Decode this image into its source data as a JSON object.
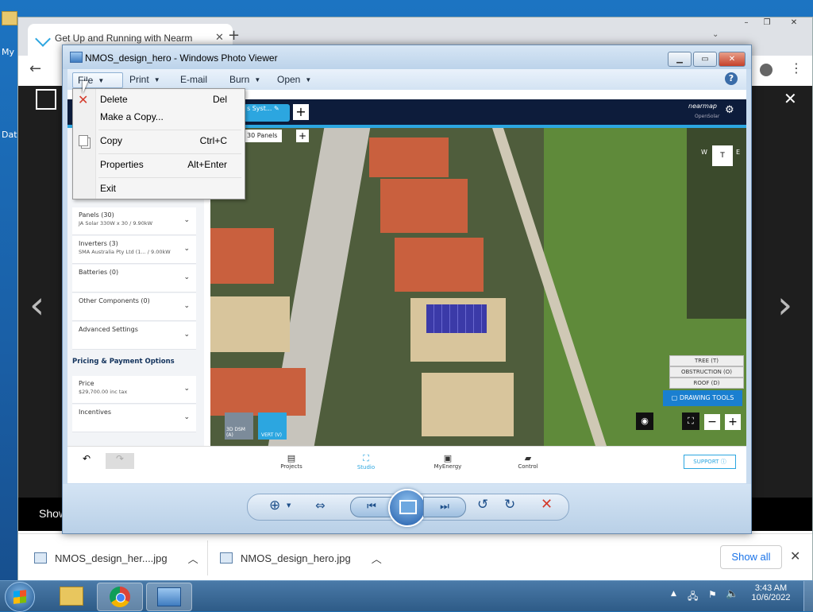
{
  "desktop": {
    "frag_top": "My",
    "frag_mid": "Dat"
  },
  "chrome": {
    "tab_title": "Get Up and Running with Nearm",
    "tab_close": "✕",
    "new_tab": "+",
    "caption_buttons": [
      "–",
      "❐",
      "✕"
    ],
    "page_footer_text": "Show",
    "prev_arrow": "‹",
    "next_arrow": "›",
    "close_overlay": "✕",
    "downloads": [
      {
        "name": "NMOS_design_her....jpg"
      },
      {
        "name": "NMOS_design_hero.jpg"
      }
    ],
    "show_all": "Show all",
    "downloads_close": "✕"
  },
  "viewer": {
    "title": "NMOS_design_hero - Windows Photo Viewer",
    "menu": {
      "file": "File",
      "print": "Print",
      "email": "E-mail",
      "burn": "Burn",
      "open": "Open"
    },
    "help": "?",
    "file_menu": [
      {
        "label": "Delete",
        "shortcut": "Del"
      },
      {
        "label": "Make a Copy...",
        "shortcut": ""
      },
      {
        "label": "Copy",
        "shortcut": "Ctrl+C"
      },
      {
        "label": "Properties",
        "shortcut": "Alt+Enter"
      },
      {
        "label": "Exit",
        "shortcut": ""
      }
    ]
  },
  "app": {
    "project_tab": "s Syst...",
    "panels_badge": "30 Panels",
    "brand": "nearmap",
    "brand_sub": "OpenSolar",
    "sidebar": {
      "rows": [
        {
          "main": "Panels (30)",
          "sub": "JA Solar 330W x 30 / 9.90kW"
        },
        {
          "main": "Inverters (3)",
          "sub": "SMA Australia Pty Ltd (1... / 9.00kW"
        },
        {
          "main": "Batteries (0)",
          "sub": ""
        },
        {
          "main": "Other Components (0)",
          "sub": ""
        },
        {
          "main": "Advanced Settings",
          "sub": ""
        }
      ],
      "pricing_title": "Pricing & Payment Options",
      "pricing_rows": [
        {
          "main": "Price",
          "sub": "$29,700.00 inc tax"
        },
        {
          "main": "Incentives",
          "sub": ""
        }
      ]
    },
    "map": {
      "view_button": "T",
      "compass_letters": "W",
      "compass_letters_2": "E",
      "tools": [
        "TREE (T)",
        "OBSTRUCTION (O)",
        "ROOF (D)"
      ],
      "drawing_tools": "DRAWING TOOLS",
      "view_3d": "3D DSM (A)",
      "view_vert": "VERT (V)",
      "zoom_minus": "−",
      "zoom_plus": "+"
    },
    "footer": {
      "nav": [
        "Projects",
        "Studio",
        "MyEnergy",
        "Control"
      ],
      "support": "SUPPORT"
    }
  },
  "taskbar": {
    "time": "3:43 AM",
    "date": "10/6/2022"
  },
  "colors": {
    "nearmap_navy": "#0d1c3b",
    "nearmap_blue": "#2ca6e0",
    "delete_red": "#d43a2a",
    "drawing_tools_bg": "#1a7fd0"
  }
}
